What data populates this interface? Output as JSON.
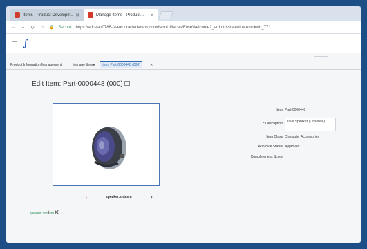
{
  "browser": {
    "tabs": [
      {
        "title": "Items - Product Developm..."
      },
      {
        "title": "Manage Items - Product..."
      }
    ],
    "address": {
      "secure_label": "Secure",
      "url": "https://adc-fap0786-fa-ext.oracledemos.com/fscmUI/faces/FuseWelcome?_adf.ctrl-state=iowAmokwb_771"
    }
  },
  "nav": {
    "crumbs": [
      "Product Information Management",
      "Manage Items",
      "Item: Part-0000448 (000)"
    ]
  },
  "page": {
    "title": "Edit Item: Part-0000448 (000)"
  },
  "image": {
    "caption": "speaker.stdasm",
    "attachment_link": "speaker.stdasm"
  },
  "form": {
    "item_label": "Item",
    "item_value": "Part-0000448",
    "description_label": "Description",
    "description_value": "Dual Speaker (Obsolete)",
    "item_class_label": "Item Class",
    "item_class_value": "Computer Accessories",
    "approval_label": "Approval Status",
    "approval_value": "Approved",
    "completeness_label": "Completeness Score",
    "required_marker": "*"
  }
}
